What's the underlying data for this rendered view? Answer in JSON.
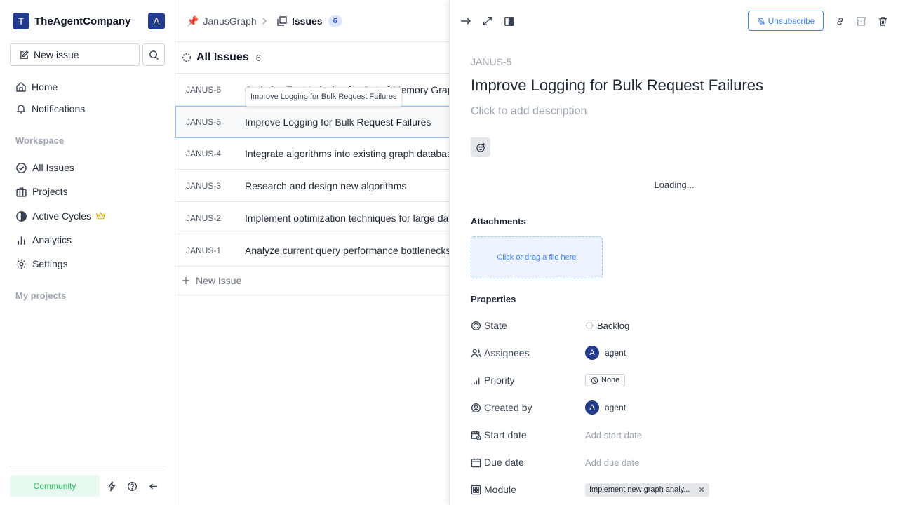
{
  "workspace": {
    "initial": "T",
    "name": "TheAgentCompany",
    "user_initial": "A"
  },
  "sidebar": {
    "new_issue_label": "New issue",
    "nav": [
      {
        "label": "Home",
        "icon": "home-icon"
      },
      {
        "label": "Notifications",
        "icon": "bell-icon"
      }
    ],
    "workspace_label": "Workspace",
    "workspace_items": [
      {
        "label": "All Issues",
        "icon": "check-circle-icon"
      },
      {
        "label": "Projects",
        "icon": "briefcase-icon"
      },
      {
        "label": "Active Cycles",
        "icon": "contrast-icon",
        "badge": "crown-icon"
      },
      {
        "label": "Analytics",
        "icon": "bar-chart-icon"
      },
      {
        "label": "Settings",
        "icon": "gear-icon"
      }
    ],
    "my_projects_label": "My projects",
    "community_label": "Community"
  },
  "breadcrumb": {
    "project": "JanusGraph",
    "section": "Issues",
    "count": "6"
  },
  "list": {
    "title": "All Issues",
    "count": "6",
    "rows": [
      {
        "id": "JANUS-6",
        "title": "Optimize Fast Indexing for Out-of-Memory Graphs"
      },
      {
        "id": "JANUS-5",
        "title": "Improve Logging for Bulk Request Failures"
      },
      {
        "id": "JANUS-4",
        "title": "Integrate algorithms into existing graph database"
      },
      {
        "id": "JANUS-3",
        "title": "Research and design new algorithms"
      },
      {
        "id": "JANUS-2",
        "title": "Implement optimization techniques for large datasets"
      },
      {
        "id": "JANUS-1",
        "title": "Analyze current query performance bottlenecks"
      }
    ],
    "new_issue_label": "New Issue",
    "tooltip": "Improve Logging for Bulk Request Failures"
  },
  "peek": {
    "unsubscribe_label": "Unsubscribe",
    "issue_key": "JANUS-5",
    "title": "Improve Logging for Bulk Request Failures",
    "description_placeholder": "Click to add description",
    "loading_text": "Loading...",
    "attachments_title": "Attachments",
    "dropzone_text": "Click or drag a file here",
    "properties_title": "Properties",
    "properties": {
      "state_label": "State",
      "state_value": "Backlog",
      "assignees_label": "Assignees",
      "assignee_initial": "A",
      "assignee_name": "agent",
      "priority_label": "Priority",
      "priority_value": "None",
      "created_label": "Created by",
      "creator_initial": "A",
      "creator_name": "agent",
      "start_label": "Start date",
      "start_value": "Add start date",
      "due_label": "Due date",
      "due_value": "Add due date",
      "module_label": "Module",
      "module_value": "Implement new graph analy..."
    }
  },
  "colors": {
    "accent": "#3b82f6",
    "brand": "#233b8c",
    "community": "#22c55e"
  }
}
